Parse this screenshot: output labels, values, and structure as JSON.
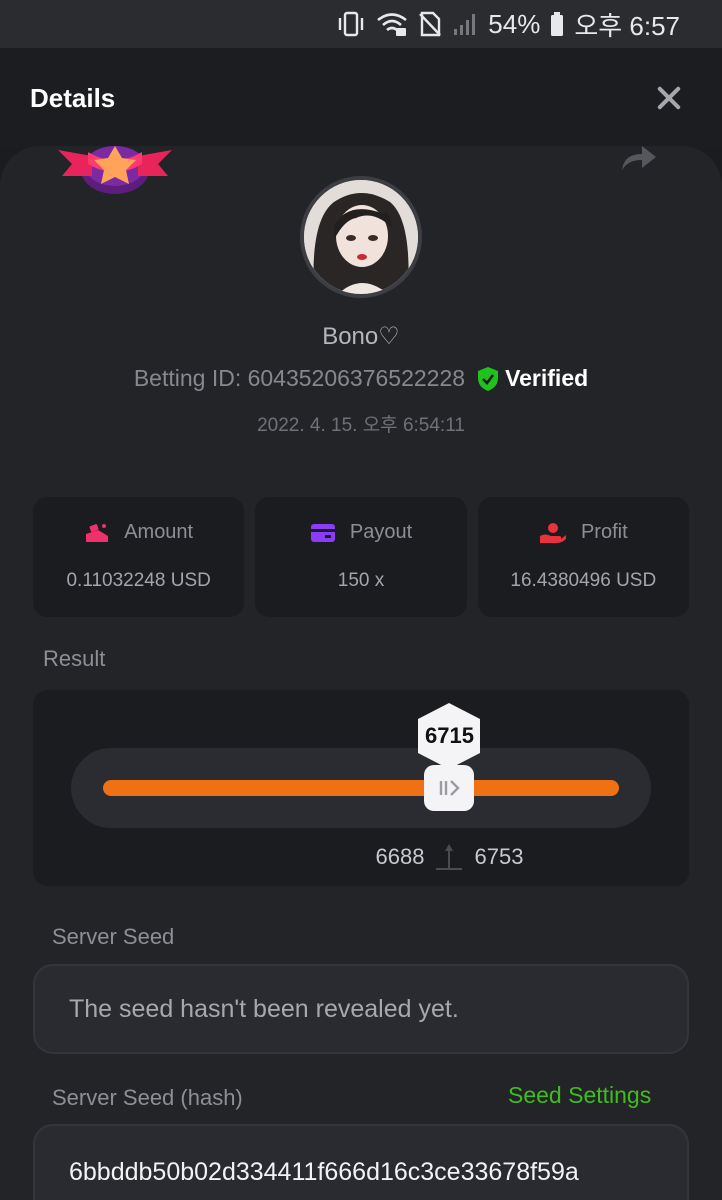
{
  "status_bar": {
    "battery_percent": "54%",
    "time": "오후 6:57"
  },
  "header": {
    "title": "Details",
    "close_icon": "close-icon"
  },
  "user": {
    "name": "Bono♡",
    "betting_id_text": "Betting ID: 60435206376522228",
    "verified_label": "Verified",
    "timestamp": "2022. 4. 15. 오후 6:54:11"
  },
  "stats": [
    {
      "label": "Amount",
      "value": "0.11032248 USD",
      "icon": "coins-icon",
      "color": "#f0306b"
    },
    {
      "label": "Payout",
      "value": "150 x",
      "icon": "card-icon",
      "color": "#8b3cf7"
    },
    {
      "label": "Profit",
      "value": "16.4380496 USD",
      "icon": "hand-coin-icon",
      "color": "#e8333d"
    }
  ],
  "result": {
    "label": "Result",
    "value": "6715",
    "range_low": "6688",
    "range_high": "6753",
    "slider_fraction": 0.6715,
    "accent_color": "#f07113"
  },
  "server_seed": {
    "label": "Server Seed",
    "text": "The seed hasn't been revealed yet."
  },
  "server_seed_hash": {
    "label": "Server Seed (hash)",
    "settings_link": "Seed Settings",
    "value": "6bbddb50b02d334411f666d16c3ce33678f59a"
  }
}
